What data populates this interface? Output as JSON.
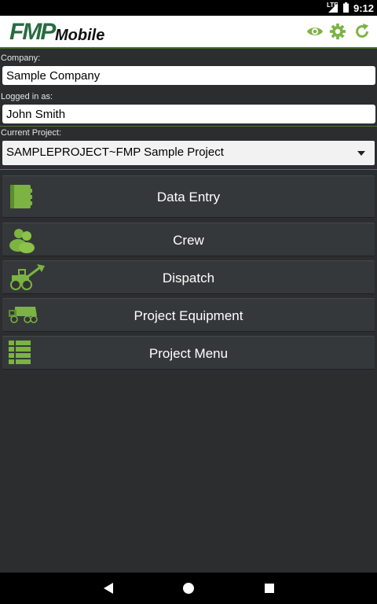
{
  "status_bar": {
    "network": "LTE",
    "time": "9:12"
  },
  "app_bar": {
    "logo_fmp": "FMP",
    "logo_mobile": "Mobile",
    "icons": [
      "eye-icon",
      "gear-icon",
      "refresh-icon"
    ],
    "accent_color": "#7cb342"
  },
  "form": {
    "company_label": "Company:",
    "company_value": "Sample Company",
    "logged_in_label": "Logged in as:",
    "logged_in_value": "John Smith",
    "project_label": "Current Project:",
    "project_value": "SAMPLEPROJECT~FMP Sample Project"
  },
  "menu": {
    "data_entry": "Data Entry",
    "crew": "Crew",
    "dispatch": "Dispatch",
    "project_equipment": "Project Equipment",
    "project_menu": "Project Menu"
  },
  "nav_bar": {
    "icons": [
      "back-icon",
      "home-icon",
      "recents-icon"
    ]
  }
}
